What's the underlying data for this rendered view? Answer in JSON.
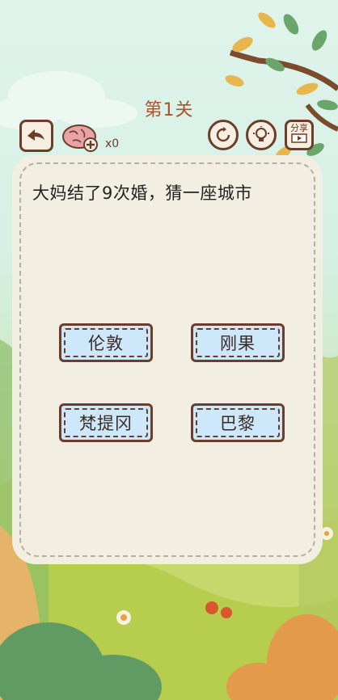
{
  "level": {
    "title": "第1关"
  },
  "hud": {
    "brain_count": "x0",
    "share_label": "分享"
  },
  "puzzle": {
    "question": "大妈结了9次婚，猜一座城市",
    "options": [
      {
        "label": "伦敦"
      },
      {
        "label": "刚果"
      },
      {
        "label": "梵提冈"
      },
      {
        "label": "巴黎"
      }
    ]
  },
  "colors": {
    "accent": "#a8552c",
    "border": "#6b3d2a",
    "option_fill": "#cde8fb",
    "card": "#f2efe2"
  },
  "icons": [
    "back-arrow-icon",
    "brain-plus-icon",
    "restart-icon",
    "hint-bulb-icon",
    "share-icon"
  ]
}
